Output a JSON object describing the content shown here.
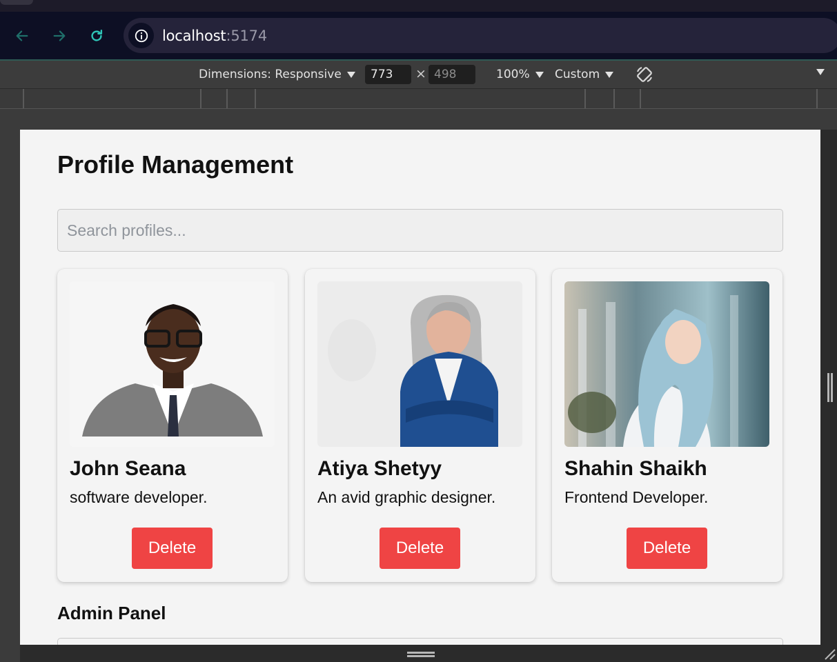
{
  "browser": {
    "url_host": "localhost",
    "url_port": ":5174",
    "icons": {
      "back": "arrow-left-icon",
      "forward": "arrow-right-icon",
      "reload": "reload-icon",
      "site_info": "info-icon"
    },
    "accent_color": "#2ec4b6"
  },
  "devtools": {
    "dimensions_label": "Dimensions: Responsive",
    "width_value": "773",
    "height_value": "498",
    "times": "×",
    "zoom": "100%",
    "throttle": "Custom"
  },
  "page": {
    "title": "Profile Management",
    "search_placeholder": "Search profiles...",
    "admin_title": "Admin Panel"
  },
  "profiles": [
    {
      "name": "John Seana",
      "bio": "software developer.",
      "delete_label": "Delete"
    },
    {
      "name": "Atiya Shetyy",
      "bio": "An avid graphic designer.",
      "delete_label": "Delete"
    },
    {
      "name": "Shahin Shaikh",
      "bio": "Frontend Developer.",
      "delete_label": "Delete"
    }
  ],
  "colors": {
    "delete_button": "#ef4444",
    "page_background": "#f4f4f4"
  }
}
